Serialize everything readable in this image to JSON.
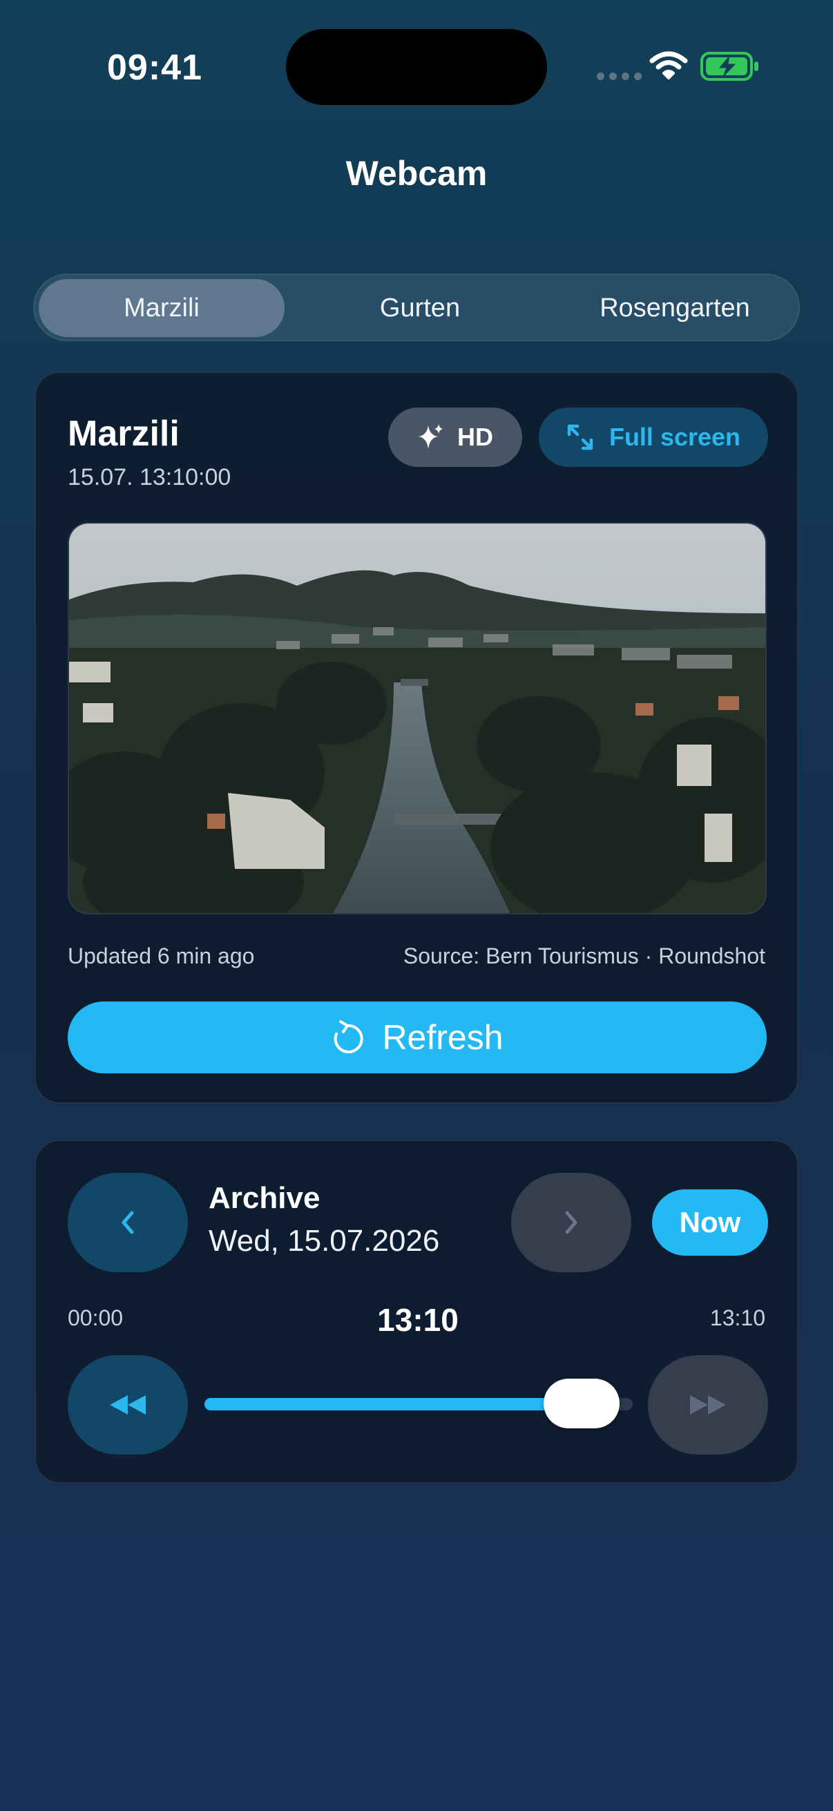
{
  "status_bar": {
    "time": "09:41",
    "icons": [
      "signal-dots-icon",
      "wifi-icon",
      "battery-charging-icon"
    ]
  },
  "header": {
    "title": "Webcam"
  },
  "tabs": [
    {
      "label": "Marzili",
      "active": true
    },
    {
      "label": "Gurten",
      "active": false
    },
    {
      "label": "Rosengarten",
      "active": false
    }
  ],
  "webcam": {
    "name": "Marzili",
    "timestamp": "15.07. 13:10:00",
    "hd_label": "HD",
    "hd_icon": "sparkles-icon",
    "fullscreen_label": "Full screen",
    "fullscreen_icon": "expand-icon",
    "updated": "Updated 6 min ago",
    "source": "Source: Bern Tourismus · Roundshot",
    "refresh_label": "Refresh",
    "refresh_icon": "refresh-icon"
  },
  "archive": {
    "label": "Archive",
    "date": "Wed, 15.07.2026",
    "now_label": "Now",
    "range_start": "00:00",
    "current_time": "13:10",
    "range_end": "13:10",
    "slider_position": 0.88,
    "prev_icon": "chevron-left-icon",
    "next_icon": "chevron-right-icon",
    "rewind_icon": "rewind-icon",
    "forward_icon": "fast-forward-icon"
  },
  "colors": {
    "accent": "#23b9f4",
    "card_bg": "#0e182a",
    "secondary_button": "#134768",
    "disabled_button": "#343e4c"
  }
}
